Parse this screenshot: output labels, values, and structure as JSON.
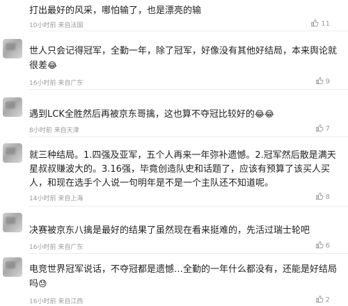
{
  "comments": [
    {
      "text": "打出最好的风采，哪怕输了，也是漂亮的输",
      "time": "10小时前",
      "location": "来自法国",
      "likes": "11",
      "emoji": ""
    },
    {
      "text": "世人只会记得冠军，全勤一年，除了冠军，好像没有其他好结局，本来舆论就很差",
      "time": "16小时前",
      "location": "来自广东",
      "likes": "9",
      "emoji": "😂"
    },
    {
      "text": "遇到LCK全胜然后再被京东哥擒，这也算不夺冠比较好的",
      "time": "8小时前",
      "location": "来自天津",
      "likes": "7",
      "emoji": "😂😂"
    },
    {
      "text": "就三种结局。1.四强及亚军，五个人再来一年弥补遗憾。2.冠军然后散是满天星叔叔赚波大的。3.16强，毕竟创造队史和话题了，应该有预算了该买人买人，和现在选手个人说一句明年是不是一个主队还不知道呢。",
      "time": "14小时前",
      "location": "来自上海",
      "likes": "8",
      "emoji": ""
    },
    {
      "text": "决赛被京东八擒是最好的结果了虽然现在看来挺难的，先活过瑞士轮吧",
      "time": "16小时前",
      "location": "来自广东",
      "likes": "6",
      "emoji": ""
    },
    {
      "text": "电竞世界冠军说话，不夺冠都是遗憾…全勤的一年什么都没有，还能是好结局吗",
      "time": "16小时前",
      "location": "来自江西",
      "likes": "2",
      "emoji": "😓"
    }
  ]
}
